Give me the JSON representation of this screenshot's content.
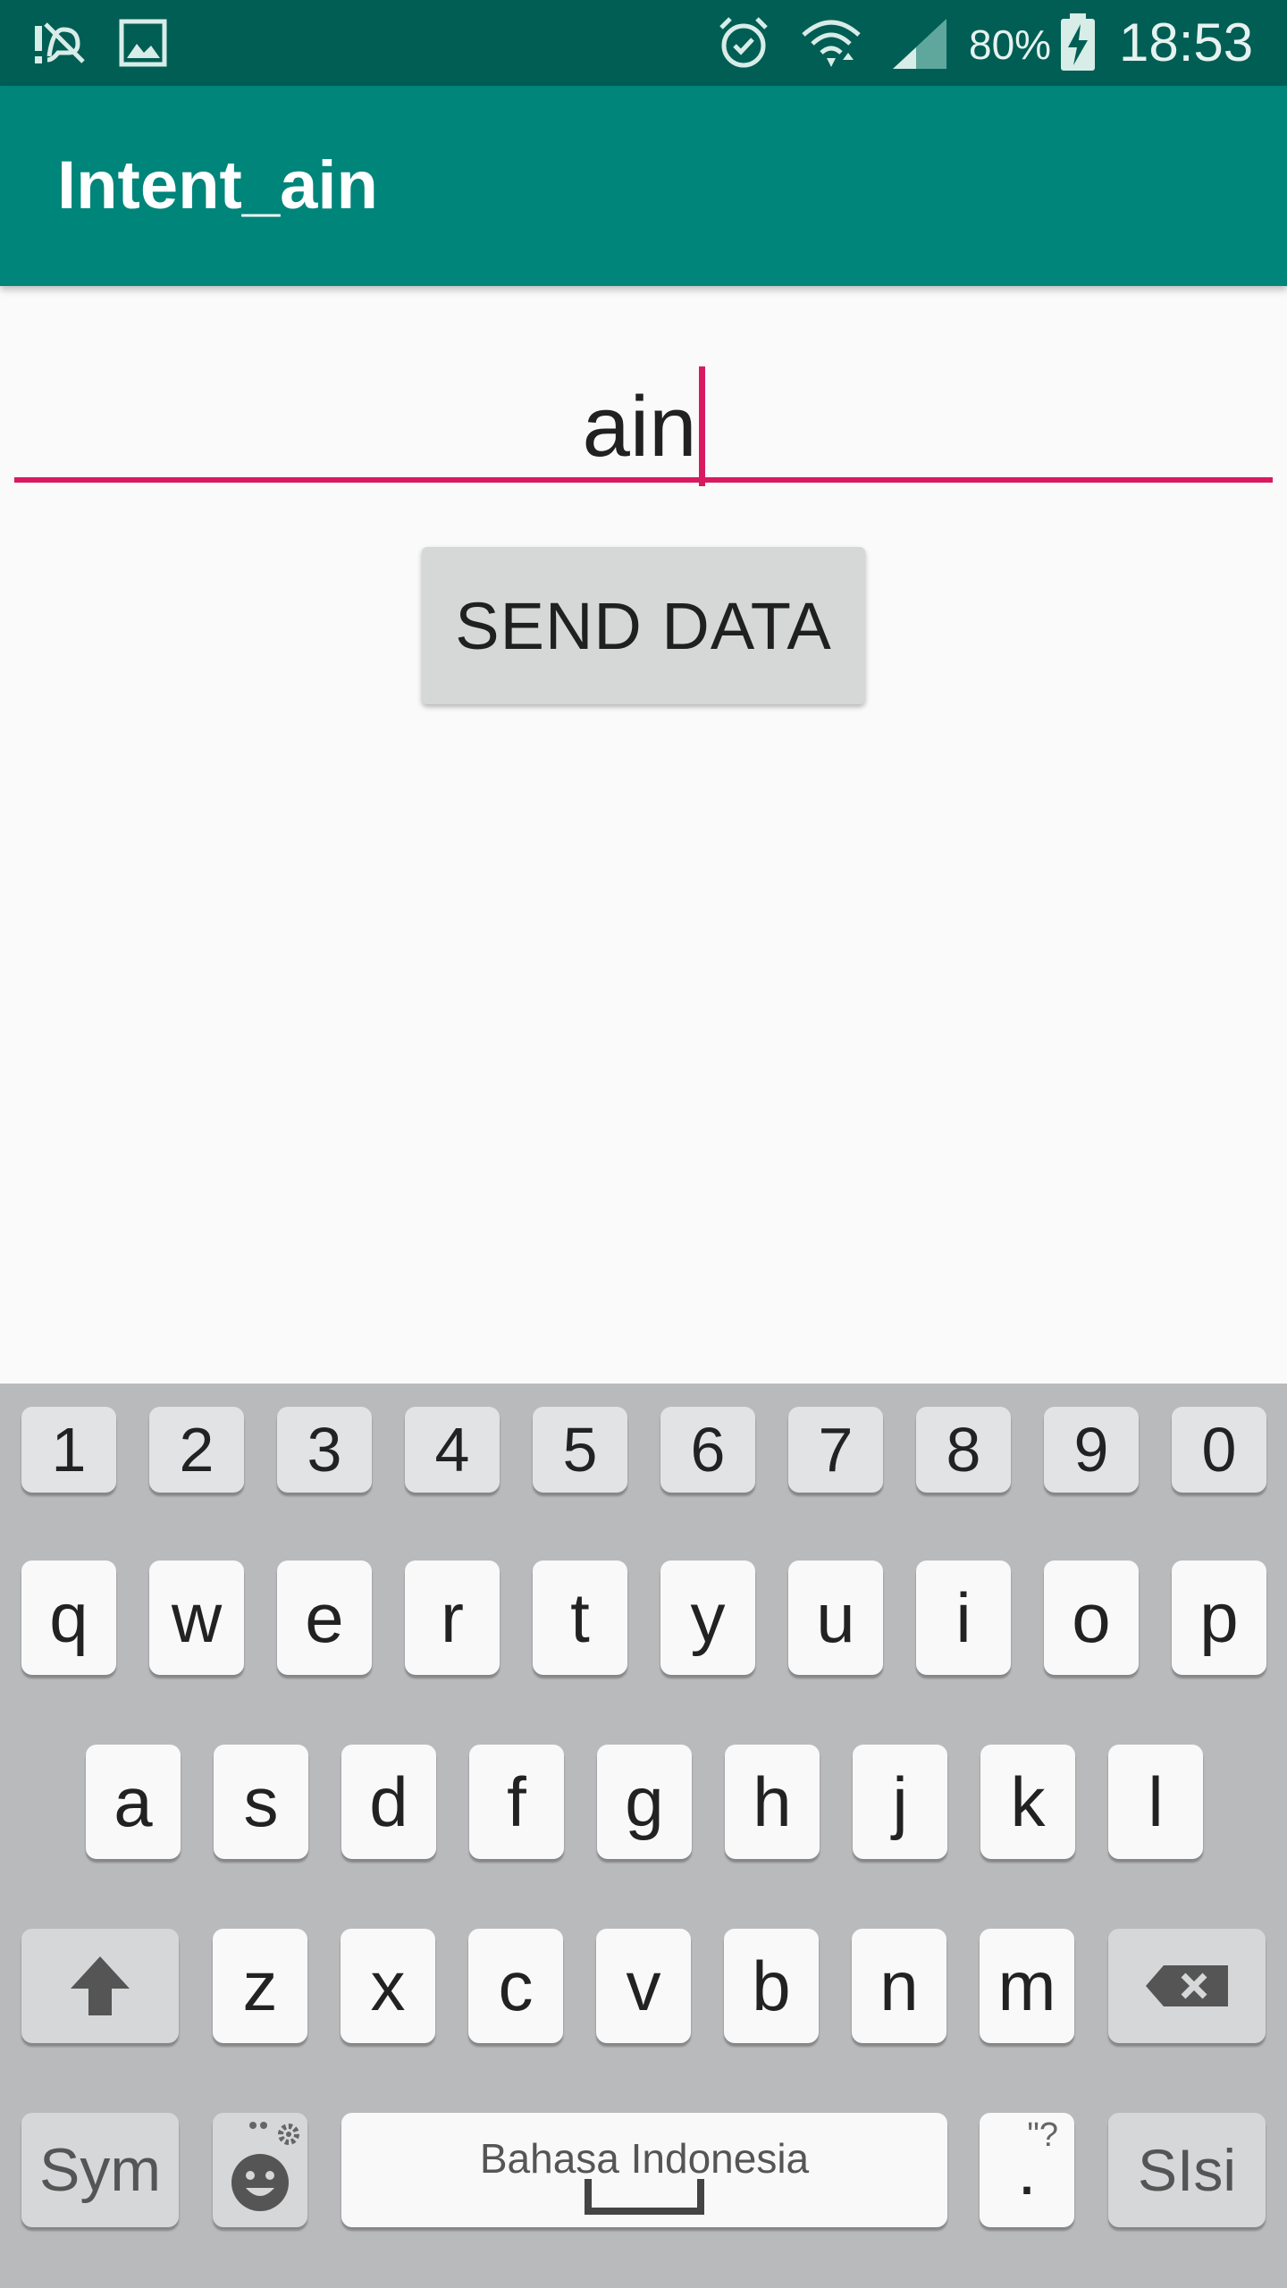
{
  "status_bar": {
    "time": "18:53",
    "battery_percent": "80%",
    "icons": [
      "notification-icon",
      "gallery-icon",
      "alarm-icon",
      "wifi-icon",
      "signal-icon",
      "battery-charging-icon"
    ]
  },
  "app_bar": {
    "title": "Intent_ain"
  },
  "input": {
    "value": "ain"
  },
  "send_button": {
    "label": "SEND DATA"
  },
  "keyboard": {
    "numbers": [
      "1",
      "2",
      "3",
      "4",
      "5",
      "6",
      "7",
      "8",
      "9",
      "0"
    ],
    "row1": [
      "q",
      "w",
      "e",
      "r",
      "t",
      "y",
      "u",
      "i",
      "o",
      "p"
    ],
    "row2": [
      "a",
      "s",
      "d",
      "f",
      "g",
      "h",
      "j",
      "k",
      "l"
    ],
    "row3": [
      "z",
      "x",
      "c",
      "v",
      "b",
      "n",
      "m"
    ],
    "sym_label": "Sym",
    "space_label": "Bahasa Indonesia",
    "period_label": ".",
    "period_hint": "\"?",
    "enter_label": "SIsi"
  },
  "colors": {
    "status_bar": "#005e54",
    "app_bar": "#00857a",
    "accent": "#d81b60",
    "keyboard_bg": "#b9babc"
  }
}
